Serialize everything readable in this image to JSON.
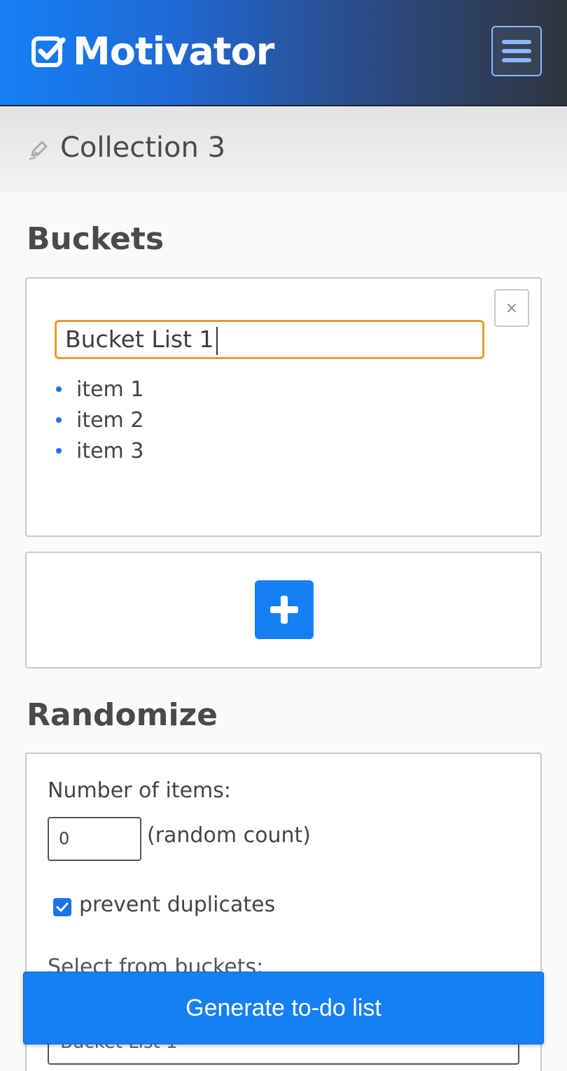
{
  "header": {
    "app_name": "Motivator",
    "logo_icon": "check-square-icon",
    "menu_icon": "hamburger-menu-icon"
  },
  "collection": {
    "title": "Collection 3",
    "edit_icon": "pencil-icon"
  },
  "buckets": {
    "heading": "Buckets",
    "close_label": "×",
    "items": [
      {
        "name": "Bucket List 1",
        "entries": [
          "item 1",
          "item 2",
          "item 3"
        ]
      }
    ],
    "add_icon": "plus-icon"
  },
  "randomize": {
    "heading": "Randomize",
    "count_label": "Number of items:",
    "count_value": "0",
    "count_hint": "(random count)",
    "prevent_duplicates_label": "prevent duplicates",
    "prevent_duplicates_checked": true,
    "select_label": "Select from buckets:",
    "selected_bucket": "Bucket List 1"
  },
  "actions": {
    "generate_label": "Generate to-do list"
  },
  "colors": {
    "primary": "#1580f5",
    "focus_border": "#e79c2d",
    "header_dark": "#2f353e"
  }
}
